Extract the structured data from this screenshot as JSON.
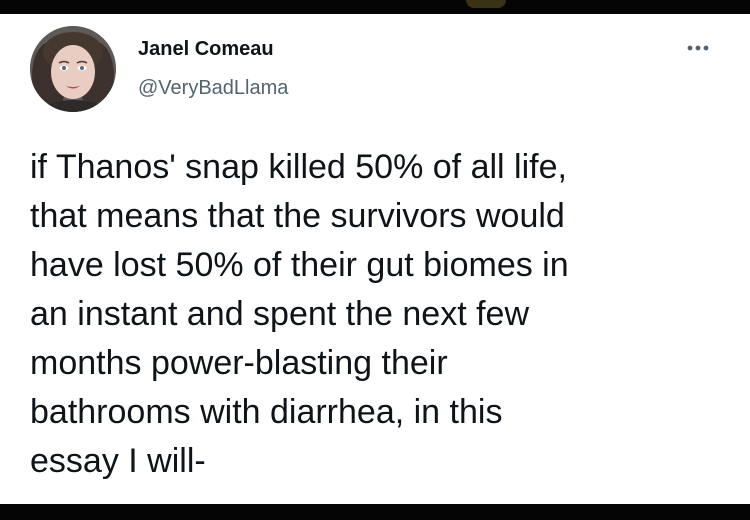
{
  "tweet": {
    "author": {
      "display_name": "Janel Comeau",
      "handle": "@VeryBadLlama",
      "avatar_icon": "profile-photo"
    },
    "more_icon": "more-horizontal-icon",
    "text": "if Thanos' snap killed 50% of all life,\nthat means that the survivors would\nhave lost 50% of their gut biomes in\nan instant and spent the next few\nmonths power-blasting their\nbathrooms with diarrhea, in this\nessay I will-"
  },
  "colors": {
    "primary_text": "#0f1419",
    "secondary_text": "#536471",
    "background": "#ffffff",
    "frame": "#000000"
  }
}
